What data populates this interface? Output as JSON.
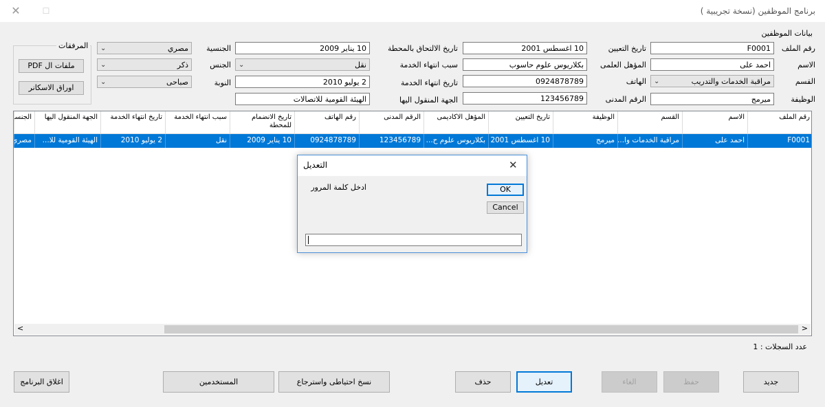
{
  "window": {
    "title": "برنامج الموظفين (نسخة تجريبية )",
    "min_glyph": "—",
    "max_glyph": "☐",
    "close_glyph": "✕"
  },
  "section_title": "بيانات الموظفين",
  "form": {
    "file_no": {
      "label": "رقم الملف",
      "value": "F0001"
    },
    "name": {
      "label": "الاسم",
      "value": "احمد على"
    },
    "department": {
      "label": "القسم",
      "value": "مراقبة الخدمات والتدريب"
    },
    "job": {
      "label": "الوظيفة",
      "value": "ميرمج"
    },
    "hire_date": {
      "label": "تاريخ التعيين",
      "value": "10 اغسطس 2001"
    },
    "qualification": {
      "label": "المؤهل العلمى",
      "value": "بكلاريوس علوم حاسوب"
    },
    "phone": {
      "label": "الهاتف",
      "value": "0924878789"
    },
    "civil_no": {
      "label": "الرقم المدنى",
      "value": "123456789"
    },
    "join_date": {
      "label": "تاريخ الالتحاق بالمحطة",
      "value": "10 يناير 2009"
    },
    "end_reason": {
      "label": "سبب انتهاء الخدمة",
      "value": "نقل"
    },
    "end_date": {
      "label": "تاريخ انتهاء الخدمة",
      "value": "2 يوليو 2010"
    },
    "transfer_to": {
      "label": "الجهة المنقول اليها",
      "value": "الهيئة القومية للاتصالات"
    },
    "nationality": {
      "label": "الجنسية",
      "value": "مصري"
    },
    "gender": {
      "label": "الجنس",
      "value": "ذكر"
    },
    "shift": {
      "label": "النوبة",
      "value": "صباحى"
    }
  },
  "attachments": {
    "title": "المرفقات",
    "pdf_button": "ملفات ال PDF",
    "scan_button": "اوراق الاسكانر"
  },
  "grid": {
    "columns": [
      "رقم الملف",
      "الاسم",
      "القسم",
      "الوظيفة",
      "تاريخ التعيين",
      "المؤهل الاكاديمى",
      "الرقم المدنى",
      "رقم الهاتف",
      "تاريخ الانضمام للمحطة",
      "سبب انتهاء الخدمة",
      "تاريخ انتهاء الخدمة",
      "الجهة المنقول اليها",
      "الجنسية"
    ],
    "row": [
      "F0001",
      "احمد على",
      "مراقبة الخدمات وا...",
      "ميرمج",
      "10 اغسطس 2001",
      "بكلاريوس علوم ح...",
      "123456789",
      "0924878789",
      "10 يناير 2009",
      "نقل",
      "2 يوليو 2010",
      "الهيئة القومية للا...",
      "مصري"
    ],
    "scroll_left": "<",
    "scroll_right": ">"
  },
  "record_count": "عدد السجلات : 1",
  "buttons": {
    "new": "جديد",
    "save": "حفظ",
    "cancel": "الغاء",
    "edit": "تعديل",
    "delete": "حذف",
    "backup": "نسخ احتياطى واسترجاع",
    "users": "المستخدمين",
    "close_program": "اغلاق البرنامج"
  },
  "dialog": {
    "title": "التعديل",
    "close_glyph": "✕",
    "prompt": "ادخل كلمة المرور",
    "ok": "OK",
    "cancel": "Cancel",
    "password_value": ""
  },
  "combo_arrow": "⌄"
}
